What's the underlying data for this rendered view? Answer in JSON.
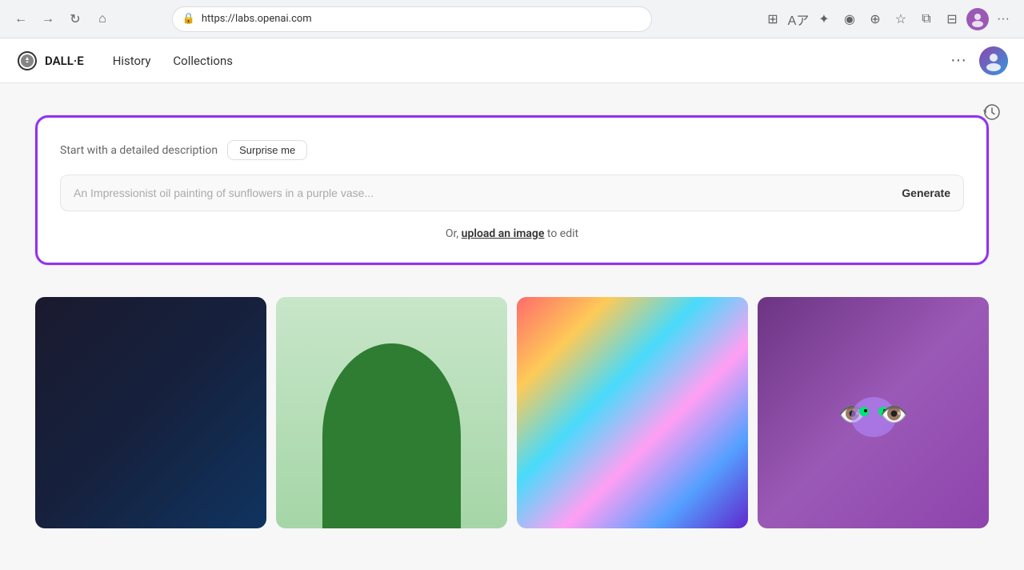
{
  "browser": {
    "url": "https://labs.openai.com",
    "back_label": "←",
    "forward_label": "→",
    "refresh_label": "↻",
    "home_label": "⌂",
    "more_label": "···"
  },
  "appbar": {
    "logo_alt": "OpenAI",
    "title": "DALL·E",
    "nav": {
      "history": "History",
      "collections": "Collections"
    },
    "more_label": "···"
  },
  "generator": {
    "label": "Start with a detailed description",
    "surprise_label": "Surprise me",
    "placeholder": "An Impressionist oil painting of sunflowers in a purple vase...",
    "generate_label": "Generate",
    "upload_prefix": "Or,",
    "upload_link": "upload an image",
    "upload_suffix": "to edit"
  },
  "gallery": {
    "items": [
      {
        "id": "img1",
        "type": "dark",
        "alt": "Dark abstract image"
      },
      {
        "id": "img2",
        "type": "green-arch",
        "alt": "Green arch image"
      },
      {
        "id": "img3",
        "type": "colorful",
        "alt": "Colorful abstract painting"
      },
      {
        "id": "img4",
        "type": "monster",
        "alt": "Purple monster image"
      }
    ]
  }
}
